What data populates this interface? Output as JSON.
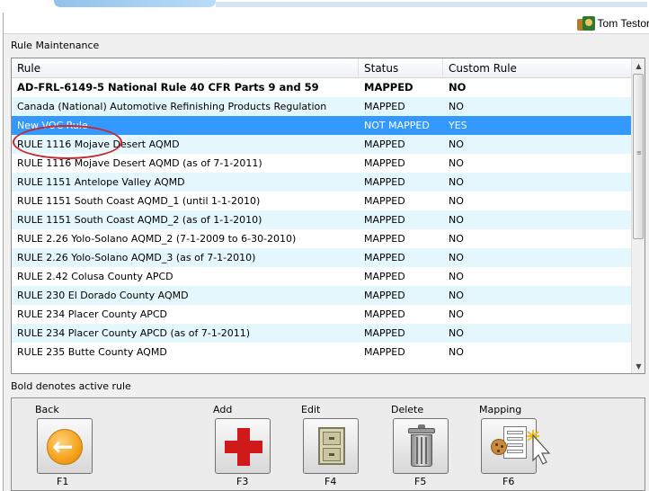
{
  "user": {
    "name": "Tom Testor"
  },
  "section_title": "Rule Maintenance",
  "grid": {
    "columns": [
      "Rule",
      "Status",
      "Custom Rule"
    ],
    "rows": [
      {
        "rule": "AD-FRL-6149-5 National Rule 40 CFR Parts 9 and 59",
        "status": "MAPPED",
        "custom": "NO",
        "bold": true
      },
      {
        "rule": "Canada (National) Automotive Refinishing Products Regulation",
        "status": "MAPPED",
        "custom": "NO"
      },
      {
        "rule": "New VOC Rule",
        "status": "NOT MAPPED",
        "custom": "YES",
        "selected": true
      },
      {
        "rule": "RULE 1116 Mojave Desert AQMD",
        "status": "MAPPED",
        "custom": "NO"
      },
      {
        "rule": "RULE 1116 Mojave Desert AQMD (as of 7-1-2011)",
        "status": "MAPPED",
        "custom": "NO"
      },
      {
        "rule": "RULE 1151 Antelope Valley AQMD",
        "status": "MAPPED",
        "custom": "NO"
      },
      {
        "rule": "RULE 1151 South Coast AQMD_1 (until 1-1-2010)",
        "status": "MAPPED",
        "custom": "NO"
      },
      {
        "rule": "RULE 1151 South Coast AQMD_2 (as of 1-1-2010)",
        "status": "MAPPED",
        "custom": "NO"
      },
      {
        "rule": "RULE 2.26 Yolo-Solano AQMD_2 (7-1-2009 to 6-30-2010)",
        "status": "MAPPED",
        "custom": "NO"
      },
      {
        "rule": "RULE 2.26 Yolo-Solano AQMD_3 (as of 7-1-2010)",
        "status": "MAPPED",
        "custom": "NO"
      },
      {
        "rule": "RULE 2.42 Colusa County APCD",
        "status": "MAPPED",
        "custom": "NO"
      },
      {
        "rule": "RULE 230 El Dorado County AQMD",
        "status": "MAPPED",
        "custom": "NO"
      },
      {
        "rule": "RULE 234 Placer County APCD",
        "status": "MAPPED",
        "custom": "NO"
      },
      {
        "rule": "RULE 234 Placer County APCD (as of 7-1-2011)",
        "status": "MAPPED",
        "custom": "NO"
      },
      {
        "rule": "RULE 235 Butte County AQMD",
        "status": "MAPPED",
        "custom": "NO"
      }
    ]
  },
  "legend": "Bold denotes active rule",
  "toolbar": {
    "back": {
      "label": "Back",
      "key": "F1",
      "icon": "back-arrow-icon"
    },
    "add": {
      "label": "Add",
      "key": "F3",
      "icon": "red-plus-icon"
    },
    "edit": {
      "label": "Edit",
      "key": "F4",
      "icon": "file-cabinet-icon"
    },
    "delete": {
      "label": "Delete",
      "key": "F5",
      "icon": "trash-can-icon"
    },
    "mapping": {
      "label": "Mapping",
      "key": "F6",
      "icon": "mapping-sheet-icon"
    }
  },
  "colors": {
    "selected_row": "#3399ff",
    "alt_row": "#e3f7fd",
    "highlight_oval": "#c8262a",
    "add_red": "#d01a1a",
    "back_orange": "#f5a11b"
  }
}
